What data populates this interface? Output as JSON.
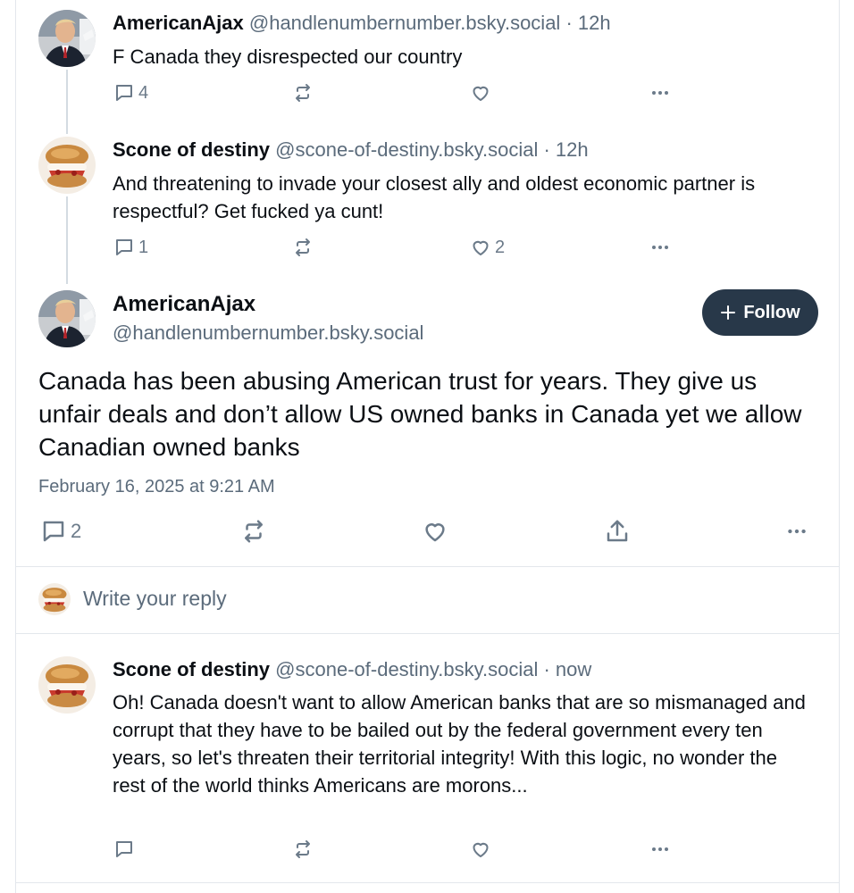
{
  "posts": [
    {
      "name": "AmericanAjax",
      "handle": "@handlenumbernumber.bsky.social",
      "time": " · 12h",
      "text": "F Canada they disrespected our country",
      "reply_count": "4",
      "repost_count": "",
      "like_count": ""
    },
    {
      "name": "Scone of destiny",
      "handle": "@scone-of-destiny.bsky.social",
      "time": " · 12h",
      "text": "And threatening to invade your closest ally and oldest economic partner is respectful? Get fucked ya cunt!",
      "reply_count": "1",
      "repost_count": "",
      "like_count": "2"
    }
  ],
  "main_post": {
    "name": "AmericanAjax",
    "handle": "@handlenumbernumber.bsky.social",
    "follow_label": "Follow",
    "text": "Canada has been abusing American trust for years. They give us unfair deals and don’t allow US owned banks in Canada yet we allow Canadian owned banks",
    "timestamp": "February 16, 2025 at 9:21 AM",
    "reply_count": "2"
  },
  "reply_box": {
    "placeholder": "Write your reply"
  },
  "reply_post": {
    "name": "Scone of destiny",
    "handle": "@scone-of-destiny.bsky.social",
    "time": " · now",
    "text": "Oh! Canada doesn't want to allow American banks that are so mismanaged and corrupt that they have to be bailed out by the federal government every ten years, so let's threaten their territorial integrity! With this logic, no wonder the rest of the world thinks Americans are morons..."
  },
  "icons": {
    "reply": "reply-icon",
    "repost": "repost-icon",
    "like": "heart-icon",
    "more": "more-icon",
    "share": "share-icon",
    "follow": "plus-icon"
  },
  "colors": {
    "follow_bg": "#283849",
    "muted": "#5b6b7b",
    "icon": "#6b7a89"
  }
}
